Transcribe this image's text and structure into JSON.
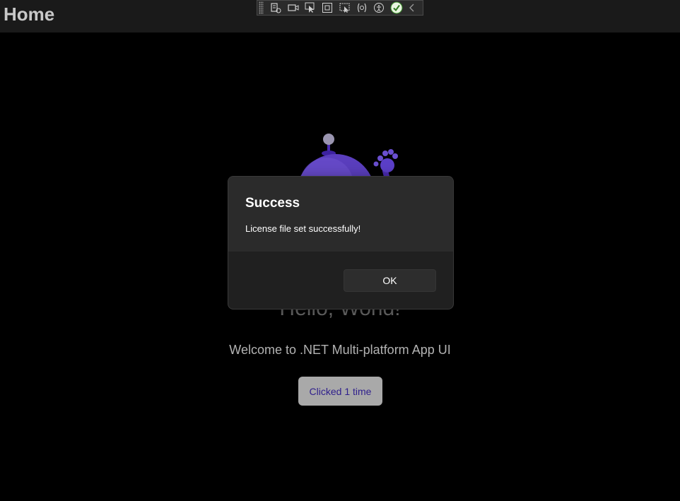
{
  "header": {
    "title": "Home"
  },
  "dev_toolbar": {
    "buttons": [
      "live-visual-tree-icon",
      "video-camera-icon",
      "select-element-icon",
      "display-layout-adorners-icon",
      "track-focused-element-icon",
      "binding-failures-icon",
      "accessibility-icon",
      "checkmark-icon",
      "collapse-chevron-icon"
    ]
  },
  "main": {
    "heading": "Hello, World!",
    "welcome": "Welcome to .NET Multi-platform App UI",
    "counter_button_label": "Clicked 1 time"
  },
  "dialog": {
    "title": "Success",
    "message": "License file set successfully!",
    "ok_label": "OK"
  },
  "colors": {
    "accent": "#512bd4",
    "background": "#000000",
    "dialog_bg": "#2b2b2b",
    "button_text": "#2e1e8c"
  }
}
